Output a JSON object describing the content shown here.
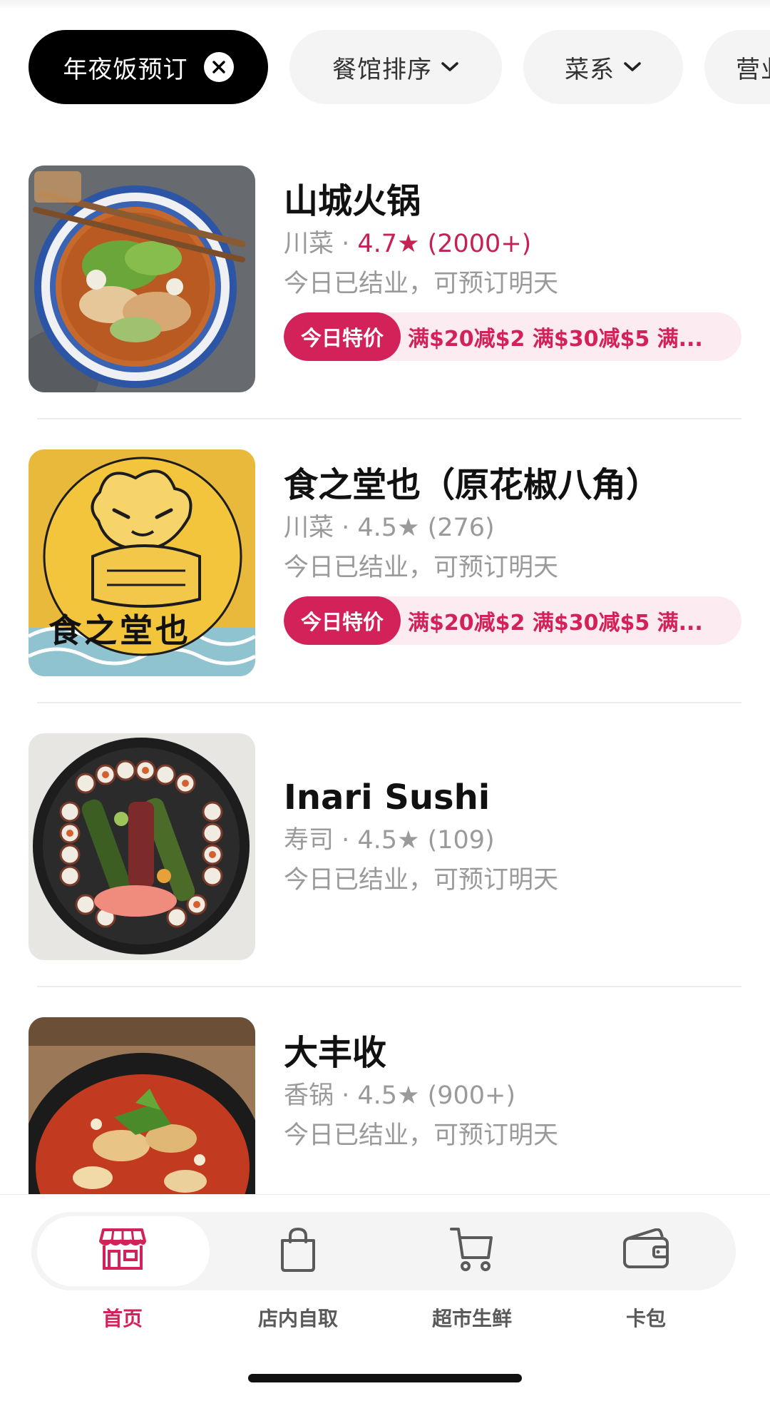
{
  "filters": {
    "active_chip": {
      "label": "年夜饭预订"
    },
    "chips": [
      {
        "label": "餐馆排序"
      },
      {
        "label": "菜系"
      },
      {
        "label": "营业"
      }
    ]
  },
  "restaurants": [
    {
      "name": "山城火锅",
      "cuisine": "川菜",
      "rating": "4.7★",
      "reviews": "(2000+)",
      "status": "今日已结业，可预订明天",
      "deal_badge": "今日特价",
      "deals": "满$20减$2  满$30减$5  满..."
    },
    {
      "name": "食之堂也（原花椒八角）",
      "cuisine": "川菜",
      "rating": "4.5★",
      "reviews": "(276)",
      "status": "今日已结业，可预订明天",
      "deal_badge": "今日特价",
      "deals": "满$20减$2  满$30减$5  满...",
      "thumb_text": "食之堂也"
    },
    {
      "name": "Inari Sushi",
      "cuisine": "寿司",
      "rating": "4.5★",
      "reviews": "(109)",
      "status": "今日已结业，可预订明天"
    },
    {
      "name": "大丰收",
      "cuisine": "香锅",
      "rating": "4.5★",
      "reviews": "(900+)",
      "status": "今日已结业，可预订明天"
    }
  ],
  "meta_separator": " · ",
  "tabs": [
    {
      "label": "首页",
      "icon": "store-icon",
      "active": true
    },
    {
      "label": "店内自取",
      "icon": "bag-icon",
      "active": false
    },
    {
      "label": "超市生鲜",
      "icon": "cart-icon",
      "active": false
    },
    {
      "label": "卡包",
      "icon": "wallet-icon",
      "active": false
    }
  ],
  "colors": {
    "accent": "#d3225a",
    "deal_bg": "#fcecf1",
    "muted_text": "#9a9a9a",
    "chip_bg": "#f4f4f5"
  }
}
